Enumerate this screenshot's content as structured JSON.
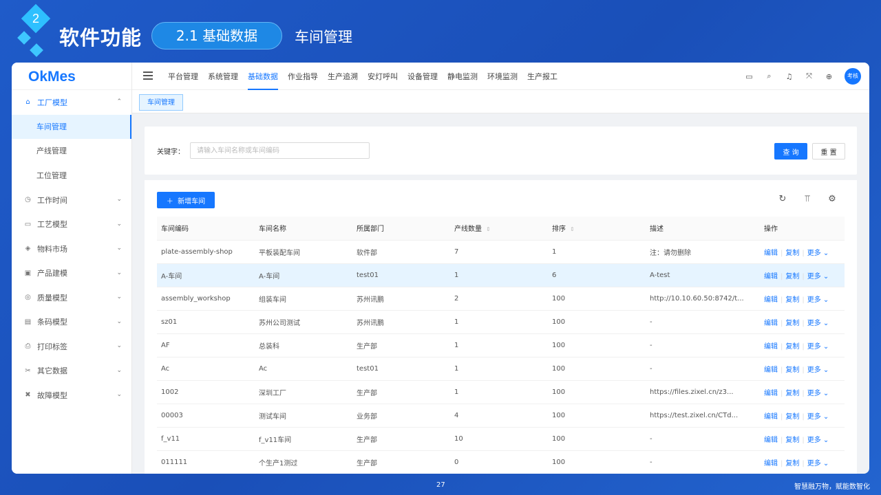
{
  "slide": {
    "section_number": "2",
    "title": "软件功能",
    "pill": "2.1 基础数据",
    "subtitle": "车间管理",
    "page_number": "27",
    "slogan": "智慧融万物，赋能数智化"
  },
  "app": {
    "logo": "OkMes",
    "sidebar": {
      "groups": [
        {
          "label": "工厂模型",
          "icon": "factory-icon",
          "open": true,
          "children": [
            "车间管理",
            "产线管理",
            "工位管理"
          ]
        },
        {
          "label": "工作时间",
          "icon": "clock-icon"
        },
        {
          "label": "工艺模型",
          "icon": "monitor-icon"
        },
        {
          "label": "物料市场",
          "icon": "box-icon"
        },
        {
          "label": "产品建模",
          "icon": "calendar-icon"
        },
        {
          "label": "质量模型",
          "icon": "shield-icon"
        },
        {
          "label": "条码模型",
          "icon": "barcode-icon"
        },
        {
          "label": "打印标签",
          "icon": "printer-icon"
        },
        {
          "label": "其它数据",
          "icon": "tools-icon"
        },
        {
          "label": "故障模型",
          "icon": "wrench-icon"
        }
      ]
    },
    "topnav": [
      "平台管理",
      "系统管理",
      "基础数据",
      "作业指导",
      "生产追溯",
      "安灯呼叫",
      "设备管理",
      "静电监测",
      "环境监测",
      "生产报工"
    ],
    "active_nav": "基础数据",
    "avatar": "考核",
    "tab": "车间管理",
    "filter": {
      "label": "关键字：",
      "placeholder": "请输入车间名称或车间编码",
      "query_button": "查 询",
      "reset_button": "重 置"
    },
    "add_button": "新增车间",
    "table": {
      "columns": [
        "车间编码",
        "车间名称",
        "所属部门",
        "产线数量",
        "排序",
        "描述",
        "操作"
      ],
      "rows": [
        [
          "plate-assembly-shop",
          "平板装配车间",
          "软件部",
          "7",
          "1",
          "注：请勿删除"
        ],
        [
          "A-车间",
          "A-车间",
          "test01",
          "1",
          "6",
          "A-test"
        ],
        [
          "assembly_workshop",
          "组装车间",
          "苏州讯鹏",
          "2",
          "100",
          "http://10.10.60.50:8742/t..."
        ],
        [
          "sz01",
          "苏州公司测试",
          "苏州讯鹏",
          "1",
          "100",
          "-"
        ],
        [
          "AF",
          "总装科",
          "生产部",
          "1",
          "100",
          "-"
        ],
        [
          "Ac",
          "Ac",
          "test01",
          "1",
          "100",
          "-"
        ],
        [
          "1002",
          "深圳工厂",
          "生产部",
          "1",
          "100",
          "https://files.zixel.cn/z3..."
        ],
        [
          "00003",
          "测试车间",
          "业务部",
          "4",
          "100",
          "https://test.zixel.cn/CTd..."
        ],
        [
          "f_v11",
          "f_v11车间",
          "生产部",
          "10",
          "100",
          "-"
        ],
        [
          "011111",
          "个生产1测过",
          "生产部",
          "0",
          "100",
          "-"
        ]
      ],
      "highlight_row": 1,
      "actions": {
        "edit": "编辑",
        "copy": "复制",
        "more": "更多"
      }
    }
  }
}
